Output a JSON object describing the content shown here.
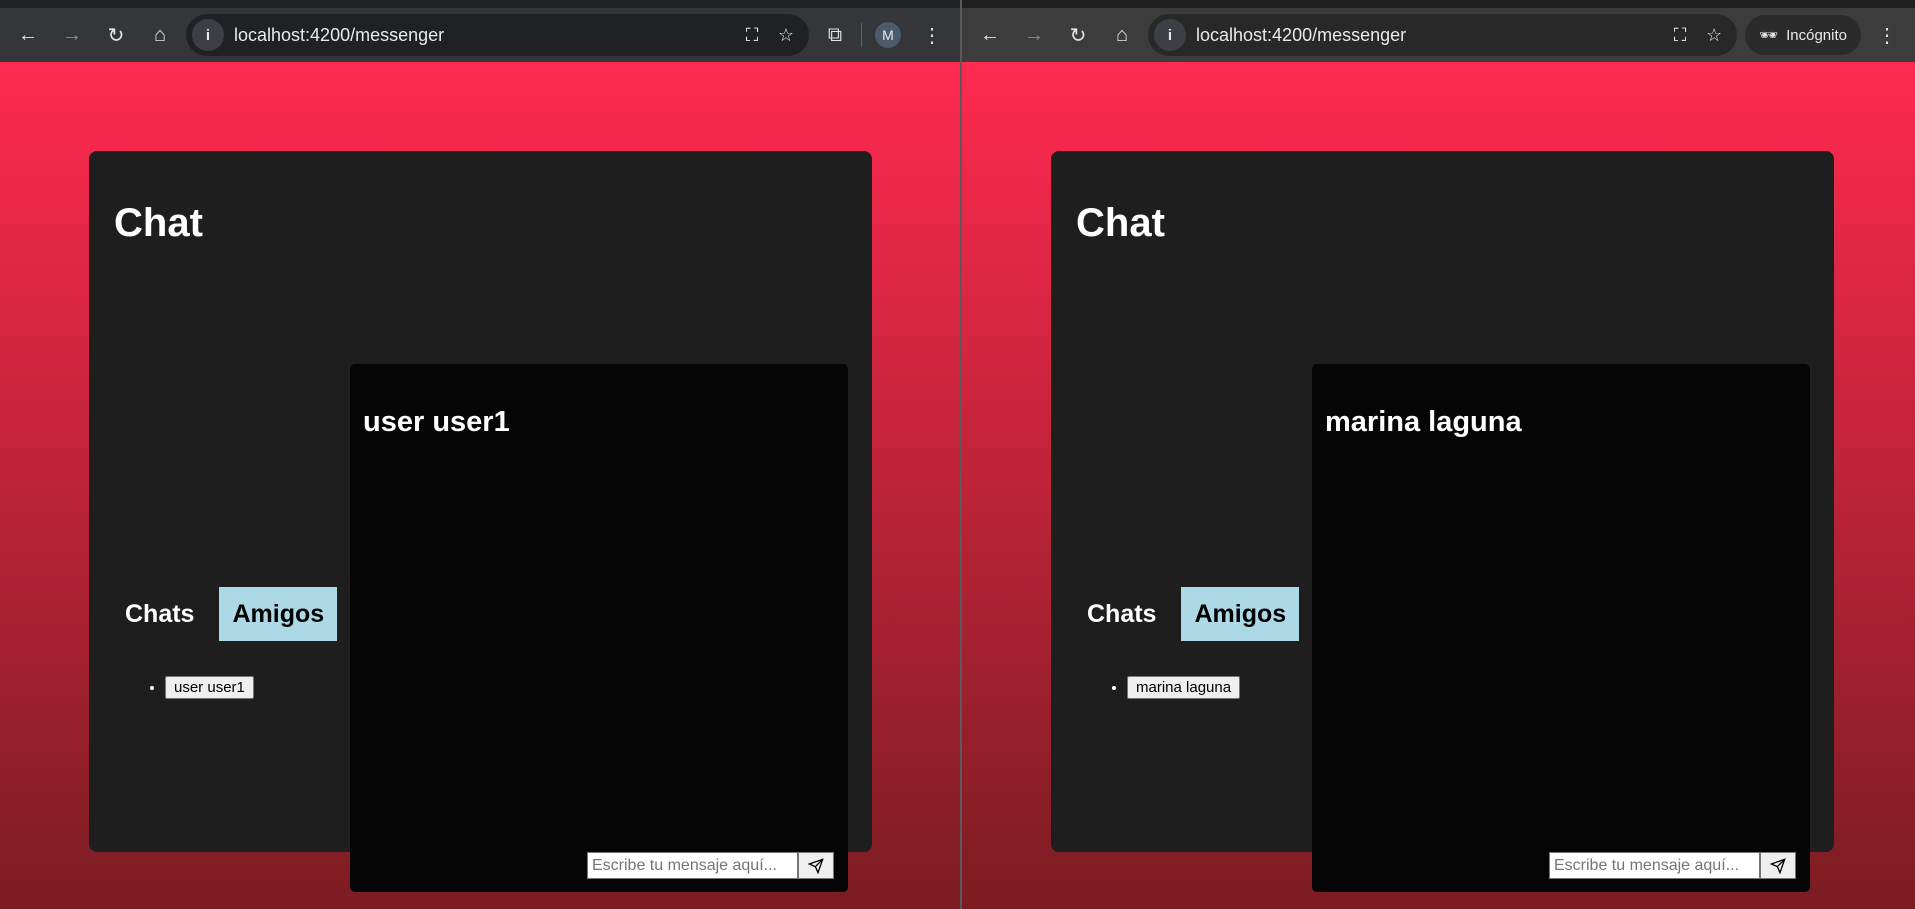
{
  "windows": [
    {
      "url": "localhost:4200/messenger",
      "profile_initial": "M",
      "incognito_label": null,
      "app": {
        "title": "Chat",
        "tabs": [
          {
            "label": "Chats",
            "active": false
          },
          {
            "label": "Amigos",
            "active": true
          }
        ],
        "friends": [
          "user user1"
        ],
        "chat_title": "user user1",
        "message_placeholder": "Escribe tu mensaje aquí..."
      }
    },
    {
      "url": "localhost:4200/messenger",
      "profile_initial": null,
      "incognito_label": "Incógnito",
      "app": {
        "title": "Chat",
        "tabs": [
          {
            "label": "Chats",
            "active": false
          },
          {
            "label": "Amigos",
            "active": true
          }
        ],
        "friends": [
          "marina laguna"
        ],
        "chat_title": "marina laguna",
        "message_placeholder": "Escribe tu mensaje aquí..."
      }
    }
  ],
  "colors": {
    "active_tab": "#add8e6",
    "gradient_top": "#ff2a50",
    "gradient_bottom": "#7b1c22"
  }
}
